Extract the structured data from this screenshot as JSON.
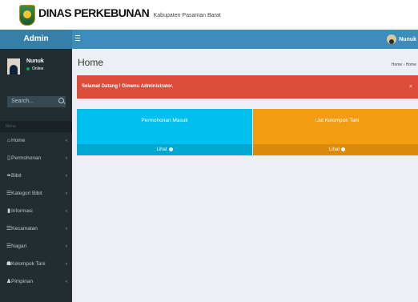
{
  "brand": {
    "title": "DINAS PERKEBUNAN",
    "subtitle": "Kabupaten Pasaman Barat"
  },
  "header": {
    "admin_label": "Admin",
    "user_name": "Nunuk"
  },
  "sidebar": {
    "user": {
      "name": "Nunuk",
      "status": "Online"
    },
    "search_placeholder": "Search...",
    "menu_header": "Menu",
    "items": [
      {
        "label": "Home",
        "icon": "home-icon",
        "glyph": "⌂"
      },
      {
        "label": "Permohonan",
        "icon": "file-icon",
        "glyph": "▯"
      },
      {
        "label": "Bibit",
        "icon": "leaf-icon",
        "glyph": "❧"
      },
      {
        "label": "Kategori Bibit",
        "icon": "list-icon",
        "glyph": "☰"
      },
      {
        "label": "Informasi",
        "icon": "document-icon",
        "glyph": "▮"
      },
      {
        "label": "Kecamatan",
        "icon": "list-icon",
        "glyph": "☰"
      },
      {
        "label": "Nagari",
        "icon": "list-icon",
        "glyph": "☰"
      },
      {
        "label": "Kelompok Tani",
        "icon": "group-icon",
        "glyph": "☗"
      },
      {
        "label": "Pimpinan",
        "icon": "user-icon",
        "glyph": "♟"
      }
    ]
  },
  "main": {
    "title": "Home",
    "breadcrumb": [
      "Home",
      "Home"
    ],
    "alert": "Selamat Datang ! Dimenu Administrator.",
    "alert_close": "×",
    "boxes": [
      {
        "label": "Permohonan Masuk",
        "footer": "Lihat",
        "color": "#00c0ef",
        "footer_color": "#00a7d0"
      },
      {
        "label": "List Kelompok Tani",
        "footer": "Lihat",
        "color": "#f39c12",
        "footer_color": "#db8b0b"
      }
    ]
  }
}
